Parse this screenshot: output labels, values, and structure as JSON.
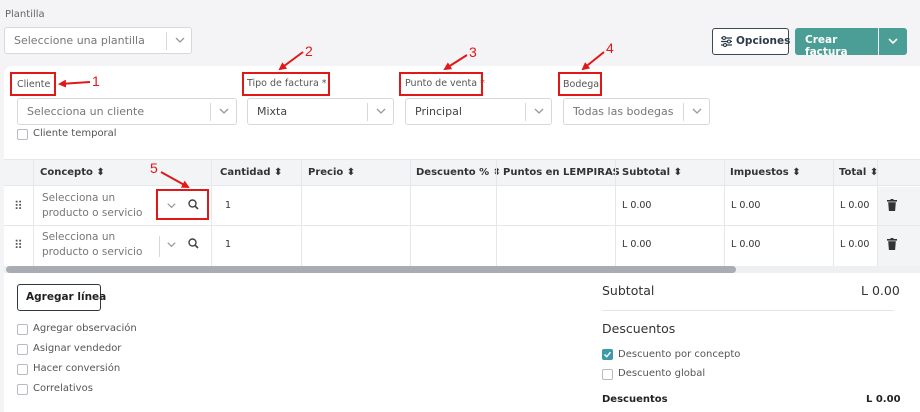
{
  "plantilla": {
    "label": "Plantilla",
    "placeholder": "Seleccione una plantilla"
  },
  "toolbar": {
    "options_label": "Opciones",
    "create_label": "Crear factura"
  },
  "fields": {
    "cliente": {
      "label": "Cliente",
      "placeholder": "Selecciona un cliente"
    },
    "tipo_factura": {
      "label": "Tipo de factura *",
      "value": "Mixta"
    },
    "punto_venta": {
      "label": "Punto de venta *",
      "value": "Principal"
    },
    "bodega": {
      "label": "Bodega",
      "value": "Todas las bodegas"
    },
    "cliente_temporal": "Cliente temporal"
  },
  "annotations": [
    "1",
    "2",
    "3",
    "4",
    "5"
  ],
  "table": {
    "columns": [
      "Concepto",
      "Cantidad",
      "Precio",
      "Descuento %",
      "Puntos en LEMPIRAS",
      "Subtotal",
      "Impuestos",
      "Total"
    ],
    "rows": [
      {
        "concepto": "Selecciona un producto o servicio",
        "cantidad": "1",
        "subtotal": "L 0.00",
        "impuestos": "L 0.00",
        "total": "L 0.00"
      },
      {
        "concepto": "Selecciona un producto o servicio",
        "cantidad": "1",
        "subtotal": "L 0.00",
        "impuestos": "L 0.00",
        "total": "L 0.00"
      }
    ]
  },
  "add_line_label": "Agregar línea",
  "options_checkboxes": [
    "Agregar observación",
    "Asignar vendedor",
    "Hacer conversión",
    "Correlativos"
  ],
  "summary": {
    "subtotal_label": "Subtotal",
    "subtotal_value": "L 0.00",
    "descuentos_title": "Descuentos",
    "descuento_concepto": "Descuento por concepto",
    "descuento_global": "Descuento global",
    "descuentos_label": "Descuentos",
    "descuentos_value": "L 0.00"
  },
  "colors": {
    "accent": "#4a9e95",
    "annotation_red": "#e01818",
    "checkbox_checked": "#3d9aa8"
  }
}
